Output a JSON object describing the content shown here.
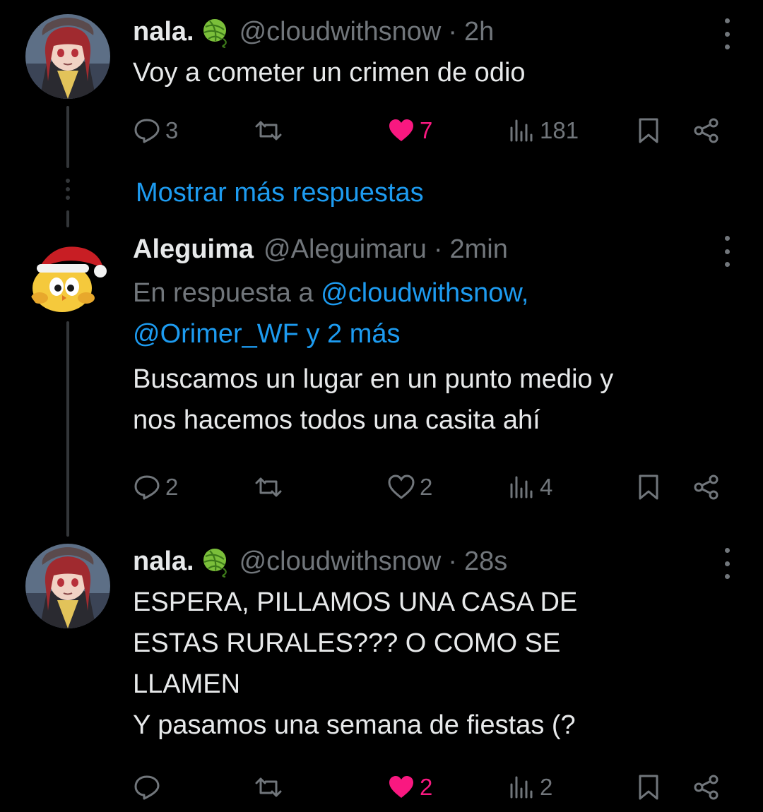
{
  "colors": {
    "background": "#000000",
    "text": "#e7e9ea",
    "muted": "#71767b",
    "accent": "#1d9bf0",
    "like": "#f91880",
    "thread_line": "#333639"
  },
  "show_more_label": "Mostrar más respuestas",
  "tweets": [
    {
      "display_name": "nala.",
      "badge_icon": "yarn-ball-emoji",
      "handle": "@cloudwithsnow",
      "separator": "·",
      "time": "2h",
      "text": "Voy a cometer un crimen de odio",
      "actions": {
        "replies": "3",
        "retweets": "",
        "likes": "7",
        "likes_active": true,
        "views": "181"
      }
    },
    {
      "display_name": "Aleguima",
      "handle": "@Aleguimaru",
      "separator": "·",
      "time": "2min",
      "reply_prefix": "En respuesta a ",
      "reply_mention_1": "@cloudwithsnow,",
      "reply_mention_2": "@Orimer_WF y 2 más",
      "text": "Buscamos un lugar en un punto medio y\nnos hacemos todos una casita ahí",
      "actions": {
        "replies": "2",
        "retweets": "",
        "likes": "2",
        "likes_active": false,
        "views": "4"
      }
    },
    {
      "display_name": "nala.",
      "badge_icon": "yarn-ball-emoji",
      "handle": "@cloudwithsnow",
      "separator": "·",
      "time": "28s",
      "text": "ESPERA, PILLAMOS UNA CASA DE\nESTAS RURALES??? O COMO SE\nLLAMEN\nY pasamos una semana de fiestas (?",
      "actions": {
        "replies": "",
        "retweets": "",
        "likes": "2",
        "likes_active": true,
        "views": "2"
      }
    }
  ]
}
